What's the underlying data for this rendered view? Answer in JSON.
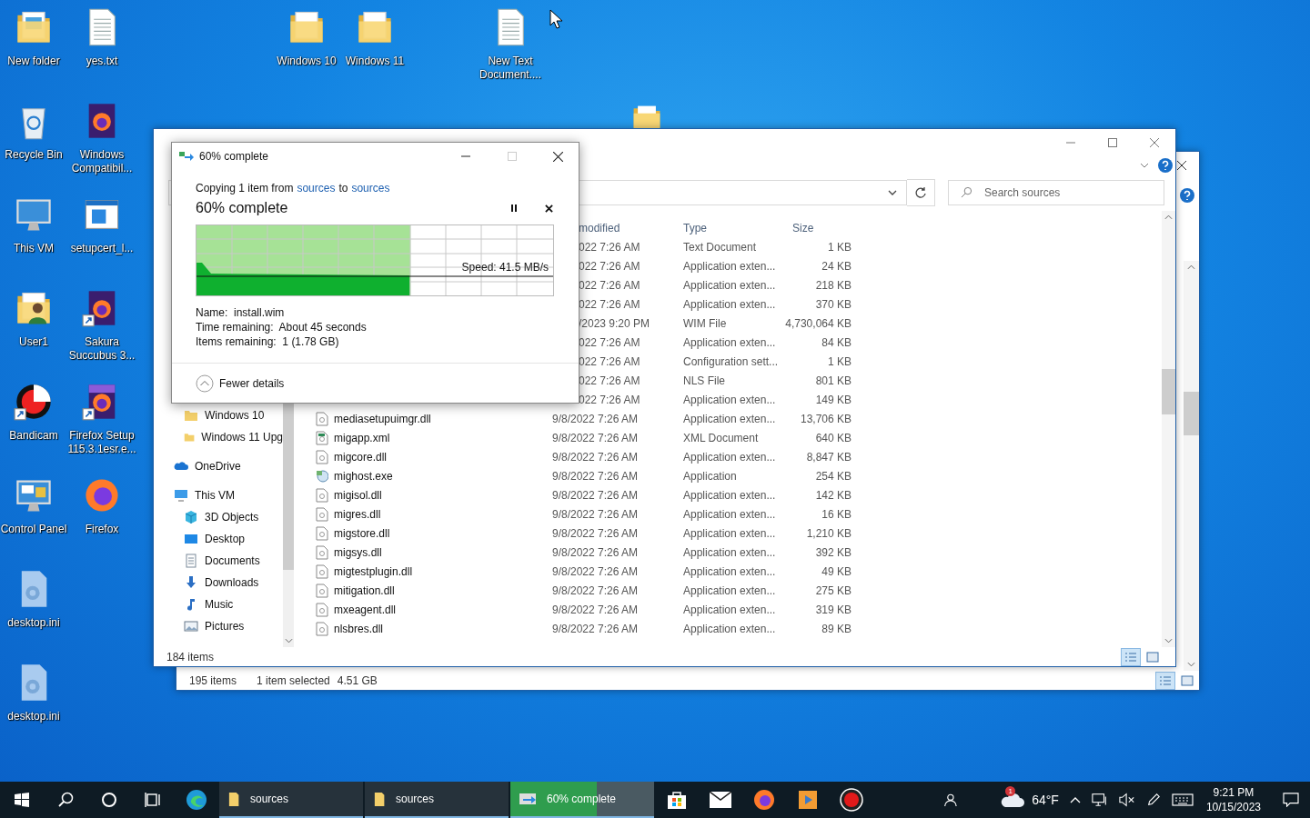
{
  "desktop": {
    "icons": [
      {
        "kind": "folder-picture",
        "label": "New folder",
        "shortcut": false
      },
      {
        "kind": "text",
        "label": "yes.txt",
        "shortcut": false
      },
      {
        "kind": "folder",
        "label": "Windows 10",
        "shortcut": false
      },
      {
        "kind": "folder",
        "label": "Windows 11",
        "shortcut": false
      },
      {
        "kind": "text",
        "label": "New Text Document....",
        "shortcut": false
      },
      {
        "kind": "recycle",
        "label": "Recycle Bin",
        "shortcut": false
      },
      {
        "kind": "app-firefox",
        "label": "Windows Compatibil...",
        "shortcut": false
      },
      {
        "kind": "pc",
        "label": "This VM",
        "shortcut": false
      },
      {
        "kind": "setup",
        "label": "setupcert_l...",
        "shortcut": false
      },
      {
        "kind": "user",
        "label": "User1",
        "shortcut": false
      },
      {
        "kind": "app-firefox",
        "label": "Sakura Succubus 3...",
        "shortcut": true
      },
      {
        "kind": "bandicam",
        "label": "Bandicam",
        "shortcut": true
      },
      {
        "kind": "firefox-setup",
        "label": "Firefox Setup 115.3.1esr.e...",
        "shortcut": true
      },
      {
        "kind": "control",
        "label": "Control Panel",
        "shortcut": false
      },
      {
        "kind": "firefox",
        "label": "Firefox",
        "shortcut": false
      },
      {
        "kind": "ini",
        "label": "desktop.ini",
        "shortcut": false
      },
      {
        "kind": "ini",
        "label": "desktop.ini",
        "shortcut": false
      }
    ]
  },
  "explorer_back": {
    "status": {
      "items": "195 items",
      "selected": "1 item selected",
      "size": "4.51 GB"
    }
  },
  "explorer": {
    "search": {
      "placeholder": "Search sources"
    },
    "columns": [
      "modified",
      "Type",
      "Size"
    ],
    "nav": {
      "pinned": [
        {
          "label": "Windows 10",
          "kind": "folder"
        },
        {
          "label": "Windows 11 Upg",
          "kind": "folder"
        }
      ],
      "items": [
        {
          "label": "OneDrive",
          "kind": "cloud"
        },
        {
          "label": "This VM",
          "kind": "pc",
          "children": [
            {
              "label": "3D Objects",
              "kind": "cube"
            },
            {
              "label": "Desktop",
              "kind": "desktop"
            },
            {
              "label": "Documents",
              "kind": "documents"
            },
            {
              "label": "Downloads",
              "kind": "downloads"
            },
            {
              "label": "Music",
              "kind": "music"
            },
            {
              "label": "Pictures",
              "kind": "pictures"
            }
          ]
        }
      ]
    },
    "rows": [
      {
        "modified": "022 7:26 AM",
        "type": "Text Document",
        "size": "1 KB"
      },
      {
        "modified": "022 7:26 AM",
        "type": "Application exten...",
        "size": "24 KB"
      },
      {
        "modified": "022 7:26 AM",
        "type": "Application exten...",
        "size": "218 KB"
      },
      {
        "modified": "022 7:26 AM",
        "type": "Application exten...",
        "size": "370 KB"
      },
      {
        "modified": "/2023 9:20 PM",
        "type": "WIM File",
        "size": "4,730,064 KB"
      },
      {
        "modified": "022 7:26 AM",
        "type": "Application exten...",
        "size": "84 KB"
      },
      {
        "modified": "022 7:26 AM",
        "type": "Configuration sett...",
        "size": "1 KB"
      },
      {
        "modified": "022 7:26 AM",
        "type": "NLS File",
        "size": "801 KB"
      },
      {
        "modified": "022 7:26 AM",
        "type": "Application exten...",
        "size": "149 KB"
      },
      {
        "kind": "dll",
        "name": "mediasetupuimgr.dll",
        "modified": "9/8/2022 7:26 AM",
        "type": "Application exten...",
        "size": "13,706 KB"
      },
      {
        "kind": "xml",
        "name": "migapp.xml",
        "modified": "9/8/2022 7:26 AM",
        "type": "XML Document",
        "size": "640 KB"
      },
      {
        "kind": "dll",
        "name": "migcore.dll",
        "modified": "9/8/2022 7:26 AM",
        "type": "Application exten...",
        "size": "8,847 KB"
      },
      {
        "kind": "exe",
        "name": "mighost.exe",
        "modified": "9/8/2022 7:26 AM",
        "type": "Application",
        "size": "254 KB"
      },
      {
        "kind": "dll",
        "name": "migisol.dll",
        "modified": "9/8/2022 7:26 AM",
        "type": "Application exten...",
        "size": "142 KB"
      },
      {
        "kind": "dll",
        "name": "migres.dll",
        "modified": "9/8/2022 7:26 AM",
        "type": "Application exten...",
        "size": "16 KB"
      },
      {
        "kind": "dll",
        "name": "migstore.dll",
        "modified": "9/8/2022 7:26 AM",
        "type": "Application exten...",
        "size": "1,210 KB"
      },
      {
        "kind": "dll",
        "name": "migsys.dll",
        "modified": "9/8/2022 7:26 AM",
        "type": "Application exten...",
        "size": "392 KB"
      },
      {
        "kind": "dll",
        "name": "migtestplugin.dll",
        "modified": "9/8/2022 7:26 AM",
        "type": "Application exten...",
        "size": "49 KB"
      },
      {
        "kind": "dll",
        "name": "mitigation.dll",
        "modified": "9/8/2022 7:26 AM",
        "type": "Application exten...",
        "size": "275 KB"
      },
      {
        "kind": "dll",
        "name": "mxeagent.dll",
        "modified": "9/8/2022 7:26 AM",
        "type": "Application exten...",
        "size": "319 KB"
      },
      {
        "kind": "dll",
        "name": "nlsbres.dll",
        "modified": "9/8/2022 7:26 AM",
        "type": "Application exten...",
        "size": "89 KB"
      }
    ],
    "status": "184 items"
  },
  "dialog": {
    "title": "60% complete",
    "copy_line": {
      "prefix": "Copying 1 item from",
      "source": "sources",
      "between": "to",
      "destination": "sources"
    },
    "heading": "60% complete",
    "level": 0.6,
    "speed": "Speed: 41.5 MB/s",
    "details": [
      "Name:  install.wim",
      "Time remaining:  About 45 seconds",
      "Items remaining:  1 (1.78 GB)"
    ],
    "toggle": "Fewer details"
  },
  "taskbar": {
    "items": [
      {
        "kind": "start"
      },
      {
        "kind": "search"
      },
      {
        "kind": "cortana"
      },
      {
        "kind": "taskview"
      },
      {
        "kind": "edge"
      },
      {
        "kind": "window",
        "label": "sources"
      },
      {
        "kind": "window",
        "label": "sources"
      },
      {
        "kind": "progress",
        "label": "60% complete",
        "level": 0.6
      },
      {
        "kind": "store"
      },
      {
        "kind": "mail"
      },
      {
        "kind": "firefox"
      },
      {
        "kind": "media"
      },
      {
        "kind": "record"
      }
    ],
    "tray": {
      "weather_badge": "1",
      "temperature": "64°F",
      "volume_muted": true,
      "time": "9:21 PM",
      "date": "10/15/2023"
    }
  }
}
